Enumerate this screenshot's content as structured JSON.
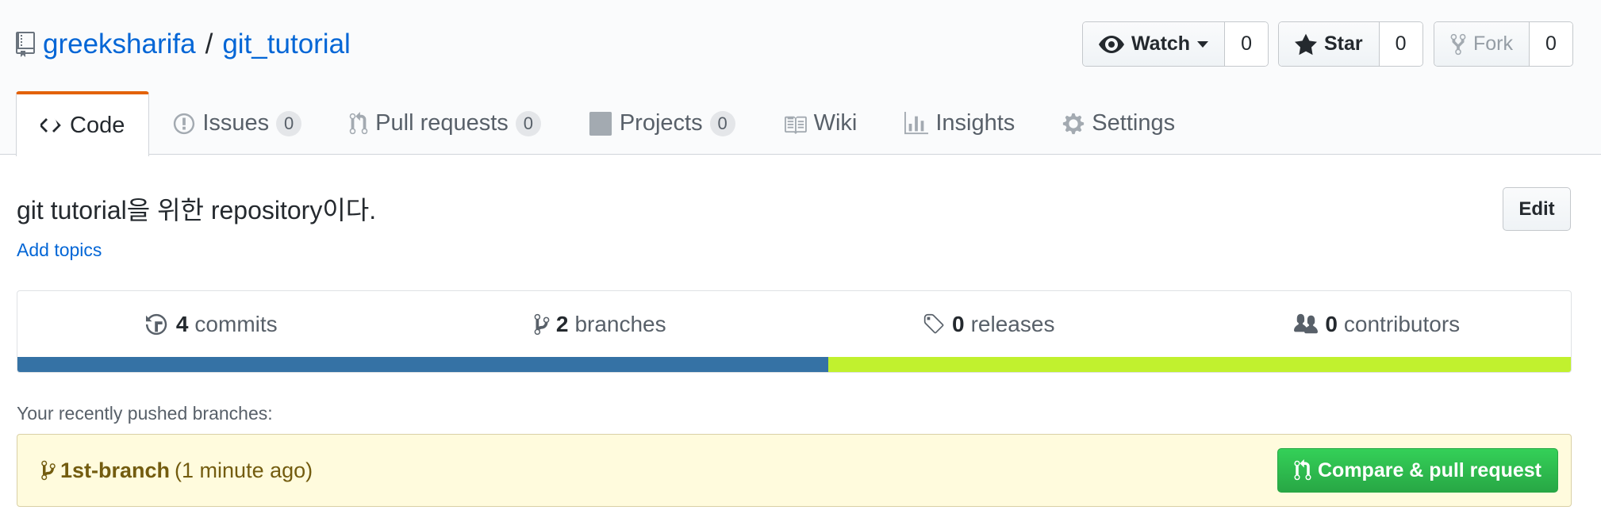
{
  "repo": {
    "owner": "greeksharifa",
    "separator": "/",
    "name": "git_tutorial"
  },
  "actions": {
    "watch": {
      "label": "Watch",
      "count": "0"
    },
    "star": {
      "label": "Star",
      "count": "0"
    },
    "fork": {
      "label": "Fork",
      "count": "0"
    }
  },
  "tabs": [
    {
      "label": "Code",
      "icon": "code-icon",
      "selected": true
    },
    {
      "label": "Issues",
      "count": "0",
      "icon": "issue-opened-icon"
    },
    {
      "label": "Pull requests",
      "count": "0",
      "icon": "git-pull-request-icon"
    },
    {
      "label": "Projects",
      "count": "0",
      "icon": "project-icon"
    },
    {
      "label": "Wiki",
      "icon": "book-icon"
    },
    {
      "label": "Insights",
      "icon": "graph-icon"
    },
    {
      "label": "Settings",
      "icon": "gear-icon"
    }
  ],
  "description": "git tutorial을 위한 repository이다.",
  "add_topics": "Add topics",
  "edit_label": "Edit",
  "summary": {
    "commits": {
      "count": "4",
      "label": "commits"
    },
    "branches": {
      "count": "2",
      "label": "branches"
    },
    "releases": {
      "count": "0",
      "label": "releases"
    },
    "contributors": {
      "count": "0",
      "label": "contributors"
    }
  },
  "language_bar": [
    {
      "percent": 52.2,
      "color": "#3572A5"
    },
    {
      "percent": 47.8,
      "color": "#c1f12e"
    }
  ],
  "recent": {
    "label": "Your recently pushed branches:",
    "branch": "1st-branch",
    "time": "(1 minute ago)",
    "compare_label": "Compare & pull request"
  },
  "colors": {
    "link": "#0366d6",
    "selected_tab_accent": "#e36209",
    "compare_button": "#28a745",
    "recent_bg": "#fffbdd"
  }
}
